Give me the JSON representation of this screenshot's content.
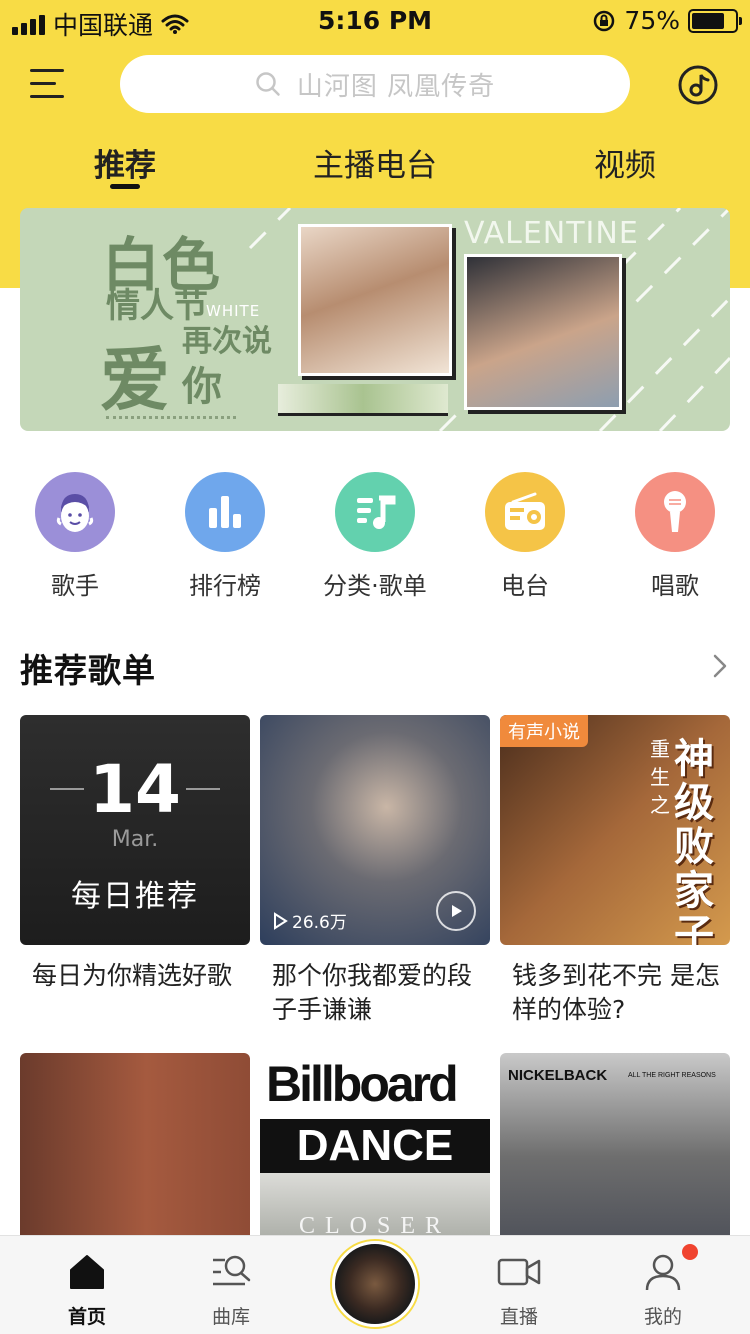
{
  "status_bar": {
    "carrier": "中国联通",
    "time": "5:16 PM",
    "battery_percent": "75%",
    "battery_level": 0.75
  },
  "search": {
    "placeholder": "山河图 凤凰传奇"
  },
  "tabs": [
    {
      "label": "推荐",
      "active": true
    },
    {
      "label": "主播电台",
      "active": false
    },
    {
      "label": "视频",
      "active": false
    }
  ],
  "banner": {
    "line1": "白色",
    "line2": "情人节",
    "white": "WHITE",
    "line3": "再次说",
    "ai": "爱",
    "ni": "你",
    "valentine": "VALENTINE"
  },
  "categories": [
    {
      "label": "歌手",
      "icon": "singer-icon",
      "color": "#9b8fd8"
    },
    {
      "label": "排行榜",
      "icon": "chart-icon",
      "color": "#6fa7ec"
    },
    {
      "label": "分类·歌单",
      "icon": "music-list-icon",
      "color": "#63d1ae"
    },
    {
      "label": "电台",
      "icon": "radio-icon",
      "color": "#f5c447"
    },
    {
      "label": "唱歌",
      "icon": "microphone-icon",
      "color": "#f59082"
    }
  ],
  "section": {
    "title": "推荐歌单"
  },
  "playlists": [
    {
      "title": "每日为你精选好歌",
      "cover_day": "14",
      "cover_month": "Mar.",
      "cover_name": "每日推荐"
    },
    {
      "title": "那个你我都爱的段子手谦谦",
      "play_count": "26.6万"
    },
    {
      "title": "钱多到花不完 是怎样的体验?",
      "tag": "有声小说",
      "cover_vtext": "神级败家子",
      "cover_small": "重生之"
    },
    {
      "title": ""
    },
    {
      "title": "",
      "cover_brand": "Billboard",
      "cover_genre": "DANCE",
      "cover_sub": "CLOSER"
    },
    {
      "title": "",
      "cover_band": "NICKELBACK",
      "cover_album": "ALL THE RIGHT REASONS"
    }
  ],
  "bottom_nav": [
    {
      "label": "首页",
      "icon": "home-icon",
      "active": true
    },
    {
      "label": "曲库",
      "icon": "library-icon",
      "active": false
    },
    {
      "label": "直播",
      "icon": "live-video-icon",
      "active": false
    },
    {
      "label": "我的",
      "icon": "profile-icon",
      "active": false
    }
  ],
  "colors": {
    "brand_yellow": "#f8dc45",
    "badge_red": "#f0432f"
  }
}
